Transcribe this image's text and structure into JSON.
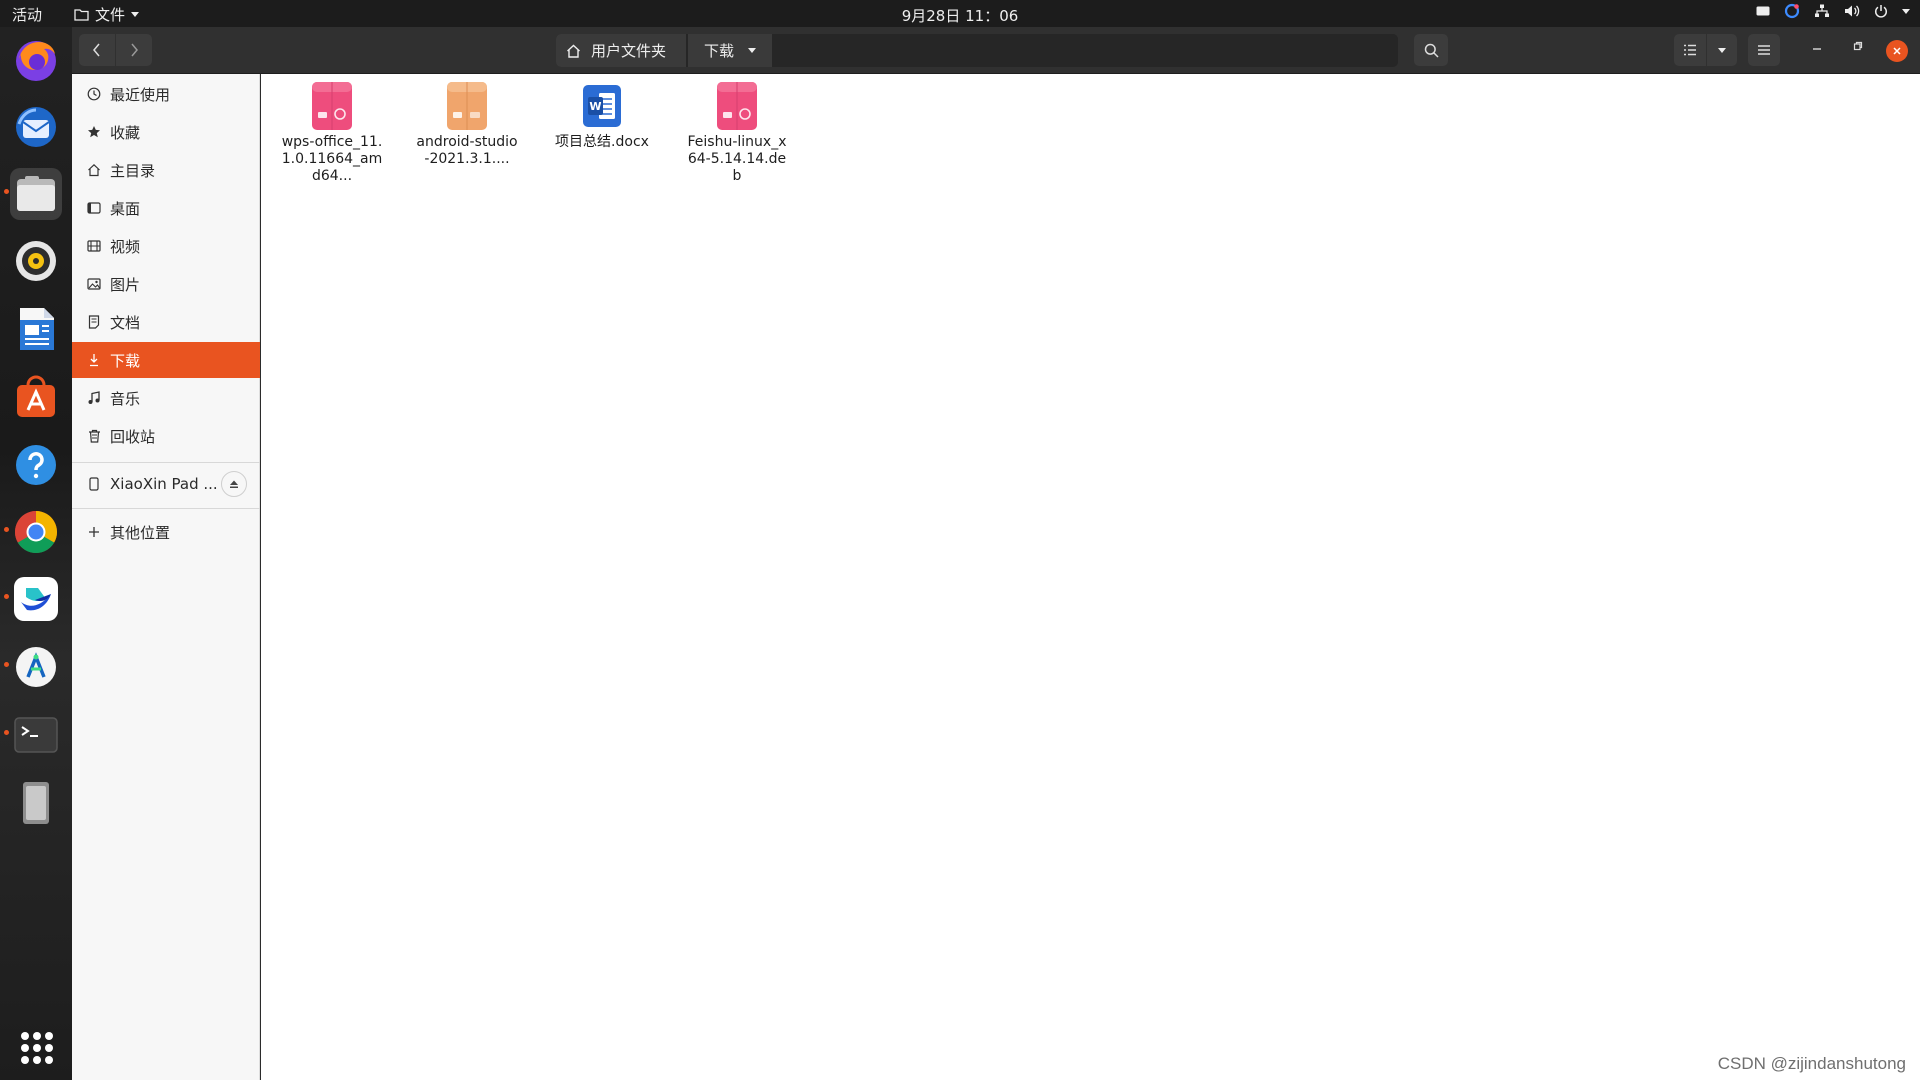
{
  "topbar": {
    "activities": "活动",
    "app_menu": "文件",
    "clock": "9月28日 11：06"
  },
  "dock": {
    "items": [
      "firefox",
      "thunderbird",
      "files",
      "rhythmbox",
      "libreoffice-writer",
      "ubuntu-software",
      "help",
      "chrome",
      "feishu",
      "android-studio",
      "terminal",
      "removable-device"
    ],
    "running": [
      "files",
      "chrome",
      "feishu",
      "android-studio",
      "terminal"
    ]
  },
  "header": {
    "path": [
      "用户文件夹",
      "下载"
    ]
  },
  "sidebar": {
    "items": [
      {
        "label": "最近使用",
        "icon": "clock-icon"
      },
      {
        "label": "收藏",
        "icon": "star-icon"
      },
      {
        "label": "主目录",
        "icon": "home-icon"
      },
      {
        "label": "桌面",
        "icon": "desktop-icon"
      },
      {
        "label": "视频",
        "icon": "video-icon"
      },
      {
        "label": "图片",
        "icon": "image-icon"
      },
      {
        "label": "文档",
        "icon": "document-icon"
      },
      {
        "label": "下载",
        "icon": "download-icon",
        "selected": true
      },
      {
        "label": "音乐",
        "icon": "music-icon"
      },
      {
        "label": "回收站",
        "icon": "trash-icon"
      }
    ],
    "device": {
      "label": "XiaoXin Pad ...",
      "icon": "phone-icon"
    },
    "other": {
      "label": "其他位置",
      "icon": "plus-icon"
    }
  },
  "files": [
    {
      "name": "wps-office_11.1.0.11664_amd64...",
      "type": "deb",
      "color": "#ee4d7d"
    },
    {
      "name": "android-studio-2021.3.1....",
      "type": "archive",
      "color": "#f0a56c"
    },
    {
      "name": "项目总结.docx",
      "type": "docx",
      "color": "#2b6cd4"
    },
    {
      "name": "Feishu-linux_x64-5.14.14.deb",
      "type": "deb",
      "color": "#ee4d7d"
    }
  ],
  "watermark": "CSDN @zijindanshutong",
  "colors": {
    "accent": "#e95420"
  }
}
